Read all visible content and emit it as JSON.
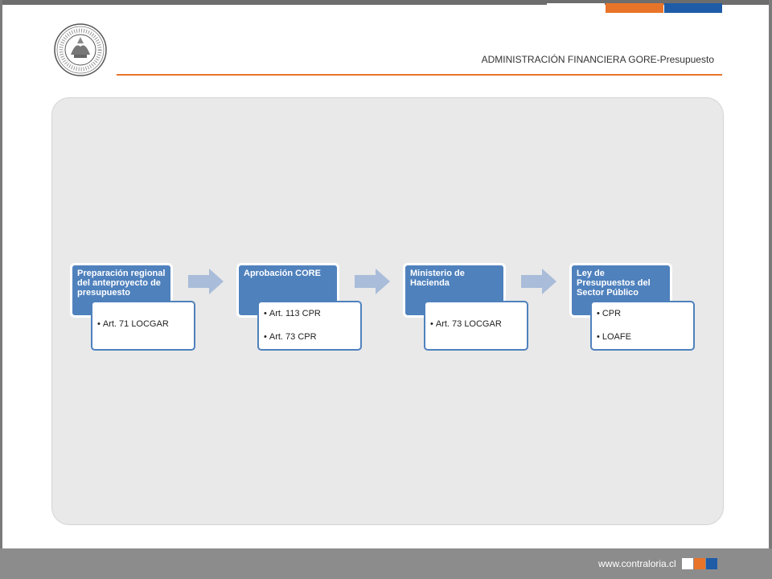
{
  "header": {
    "title": "ADMINISTRACIÓN FINANCIERA GORE-Presupuesto",
    "seal_text": "CONTRALORÍA GENERAL DE LA REPÚBLICA · CHILE · 10-II-1927"
  },
  "steps": [
    {
      "title": "Preparación regional del anteproyecto de presupuesto",
      "items": [
        "Art. 71 LOCGAR"
      ]
    },
    {
      "title": "Aprobación CORE",
      "items": [
        "Art. 113 CPR",
        "Art. 73 CPR"
      ]
    },
    {
      "title": "Ministerio de Hacienda",
      "items": [
        "Art. 73 LOCGAR"
      ]
    },
    {
      "title": "Ley de Presupuestos del Sector Público",
      "items": [
        "CPR",
        "LOAFE"
      ]
    }
  ],
  "footer": {
    "url": "www.contraloria.cl"
  },
  "colors": {
    "accent_orange": "#e8742a",
    "accent_blue": "#1f5ca8",
    "step_blue": "#4f81bd",
    "arrow": "#a9bcd9",
    "panel": "#e9e9e9",
    "footer": "#8c8c8c"
  }
}
